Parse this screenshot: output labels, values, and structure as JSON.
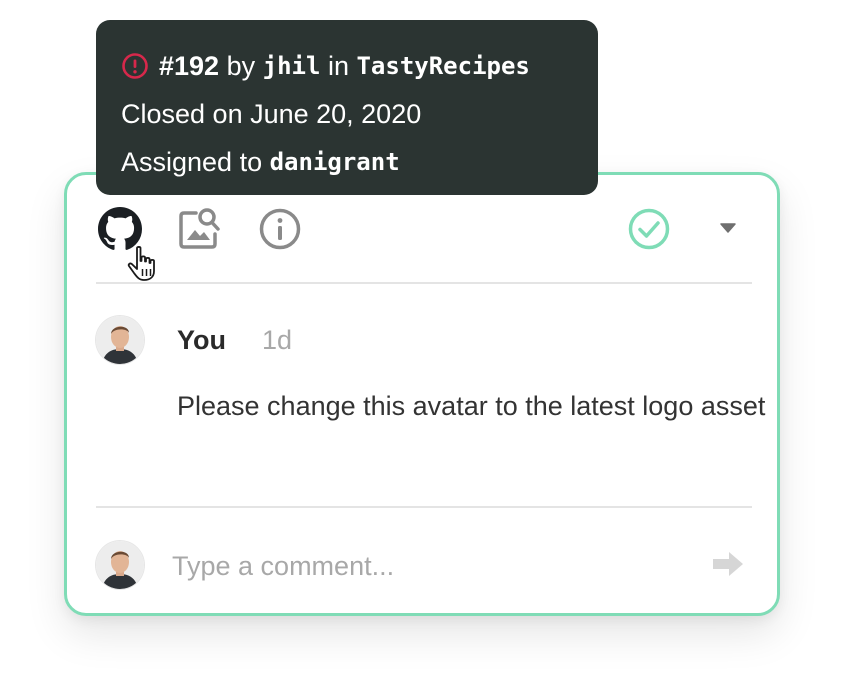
{
  "tooltip": {
    "issue_number": "#192",
    "by_word": "by",
    "author": "jhil",
    "in_word": "in",
    "repo": "TastyRecipes",
    "closed_text": "Closed on June 20, 2020",
    "assigned_prefix": "Assigned to",
    "assignee": "danigrant"
  },
  "toolbar": {
    "icons": [
      "github-icon",
      "image-search-icon",
      "info-icon",
      "check-circle-icon",
      "caret-down-icon"
    ]
  },
  "comment": {
    "author": "You",
    "time": "1d",
    "text": "Please change this avatar to the latest logo asset"
  },
  "composer": {
    "placeholder": "Type a comment..."
  },
  "colors": {
    "accent": "#7fdcb6",
    "tooltip_bg": "#2b3432",
    "issue_closed_red": "#d7284b",
    "icon_gray": "#8a8a8a",
    "send_gray": "#d6d6d6"
  }
}
